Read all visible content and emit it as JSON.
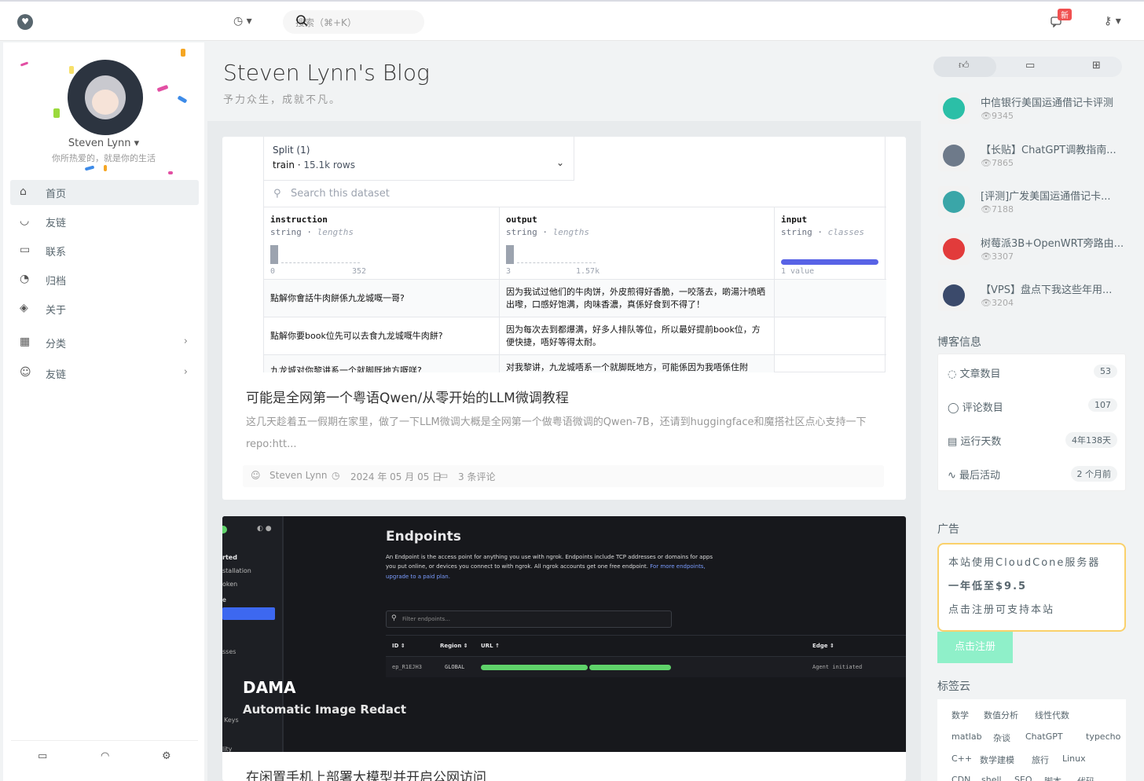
{
  "topbar": {
    "search_placeholder": "搜索（⌘+K）",
    "badge": "新"
  },
  "sidebar": {
    "user_name": "Steven Lynn",
    "user_motto": "你所热爱的，就是你的生活",
    "nav": [
      {
        "label": "首页",
        "icon": "home-icon"
      },
      {
        "label": "友链",
        "icon": "link-icon"
      },
      {
        "label": "联系",
        "icon": "chat-icon"
      },
      {
        "label": "归档",
        "icon": "archive-icon"
      },
      {
        "label": "关于",
        "icon": "tag-icon"
      },
      {
        "label": "分类",
        "icon": "grid-icon"
      },
      {
        "label": "友链",
        "icon": "user-icon"
      }
    ]
  },
  "blog": {
    "title": "Steven Lynn's Blog",
    "subtitle": "予力众生，成就不凡。"
  },
  "dataset": {
    "split_label": "Split (1)",
    "split_name": "train",
    "split_rows": "15.1k rows",
    "search_placeholder": "Search this dataset",
    "columns": [
      {
        "name": "instruction",
        "type": "string",
        "kind": "lengths",
        "min": "0",
        "max": "352"
      },
      {
        "name": "output",
        "type": "string",
        "kind": "lengths",
        "min": "3",
        "max": "1.57k"
      },
      {
        "name": "input",
        "type": "string",
        "kind": "classes",
        "min": "1 value",
        "max": ""
      }
    ],
    "rows": [
      {
        "instruction": "點解你會話牛肉餅係九龙城嘅一哥?",
        "output": "因为我试过他们的牛肉饼，外皮煎得好香脆，一咬落去，啲湯汁喷晒出嚟，口感好饱满，肉味香濃，真係好食到不得了！"
      },
      {
        "instruction": "點解你要book位先可以去食九龙城嘅牛肉餅?",
        "output": "因为每次去到都爆满，好多人排队等位，所以最好提前book位，方便快捷，唔好等得太耐。"
      },
      {
        "instruction": "九龙城对你黎讲系一个就脚既地方嘅咩?",
        "output": "对我黎讲，九龙城唔系一个就脚既地方，可能係因为我唔係住附"
      }
    ]
  },
  "posts": [
    {
      "title": "可能是全网第一个粤语Qwen/从零开始的LLM微调教程",
      "excerpt": "这几天趁着五一假期在家里，做了一下LLM微调大概是全网第一个做粤语微调的Qwen-7B，还请到huggingface和魔搭社区点心支持一下repo:htt...",
      "author": "Steven Lynn",
      "date": "2024 年 05 月 05 日",
      "comments": "3 条评论"
    },
    {
      "title": "在闲置手机上部署大模型并开启公网访问"
    }
  ],
  "endpoints_img": {
    "heading": "Endpoints",
    "desc1": "An Endpoint is the access point for anything you use with ngrok. Endpoints include TCP addresses or domains for apps",
    "desc2": "you put online, or devices you connect to with ngrok. All ngrok accounts get one free endpoint.",
    "link1": "For more endpoints,",
    "link2": "upgrade to a paid plan.",
    "filter": "Filter endpoints...",
    "cols": [
      "ID",
      "Region",
      "URL",
      "Edge"
    ],
    "row_id": "ep_R1EJH3",
    "row_region": "GLOBAL",
    "row_edge": "Agent initiated",
    "side_items": [
      "rted",
      "stallation",
      "oken",
      "e",
      "sses",
      "Keys",
      "lity"
    ],
    "overlay_title": "DAMA",
    "overlay_sub": "Automatic Image Redact"
  },
  "popular": [
    {
      "title": "中信银行美国运通借记卡评测",
      "views": "9345",
      "color": "#2bbfa7"
    },
    {
      "title": "【长贴】ChatGPT调教指南...",
      "views": "7865",
      "color": "#6e7a8a"
    },
    {
      "title": "[评测]广发美国运通借记卡...",
      "views": "7188",
      "color": "#3aa6a8"
    },
    {
      "title": "树莓派3B+OpenWRT旁路由...",
      "views": "3307",
      "color": "#e23b3b"
    },
    {
      "title": "【VPS】盘点下我这些年用...",
      "views": "3204",
      "color": "#3b4a6b"
    }
  ],
  "blog_info": {
    "title": "博客信息",
    "rows": [
      {
        "label": "文章数目",
        "value": "53",
        "icon": "bulb-icon"
      },
      {
        "label": "评论数目",
        "value": "107",
        "icon": "comment-icon"
      },
      {
        "label": "运行天数",
        "value": "4年138天",
        "icon": "calendar-icon"
      },
      {
        "label": "最后活动",
        "value": "2 个月前",
        "icon": "pulse-icon"
      }
    ]
  },
  "ad": {
    "title": "广告",
    "line1": "本站使用CloudCone服务器",
    "line2": "一年低至$9.5",
    "line3": "点击注册可支持本站",
    "button": "点击注册"
  },
  "tags": {
    "title": "标签云",
    "items": [
      "数学",
      "数值分析",
      "线性代数",
      "matlab",
      "杂谈",
      "ChatGPT",
      "typecho",
      "C++",
      "数学建模",
      "旅行",
      "Linux",
      "CDN",
      "shell",
      "SEO",
      "脚本",
      "代码"
    ]
  }
}
